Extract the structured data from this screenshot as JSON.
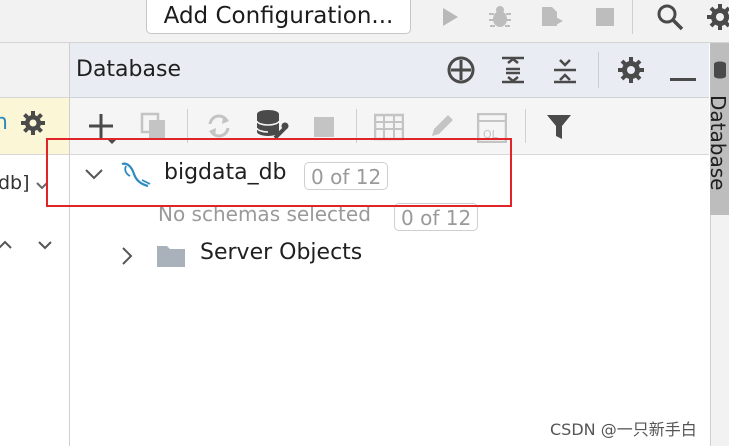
{
  "toolbar": {
    "add_configuration_label": "Add Configuration...",
    "icons": [
      "run-icon",
      "debug-icon",
      "coverage-icon",
      "stop-icon",
      "search-icon",
      "settings-icon"
    ]
  },
  "left_panel": {
    "db_label": "db]"
  },
  "database_panel": {
    "title": "Database",
    "header_icons": [
      "crosshair-icon",
      "expand-all-icon",
      "collapse-all-icon",
      "gear-icon",
      "minimize-icon"
    ],
    "toolbar_icons": [
      "add-icon",
      "duplicate-icon",
      "refresh-icon",
      "data-source-properties-icon",
      "stop-icon",
      "table-icon",
      "edit-icon",
      "query-console-icon",
      "filter-icon"
    ]
  },
  "tree": {
    "datasource": {
      "name": "bigdata_db",
      "count": "0 of 12"
    },
    "schemas": {
      "label": "No schemas selected",
      "count": "0 of 12"
    },
    "server_objects": {
      "label": "Server Objects"
    }
  },
  "right_sidebar": {
    "tab_label": "Database"
  },
  "watermark": "CSDN @一只新手白",
  "colors": {
    "highlight": "#e0242a",
    "header_bg": "#e9ecf2",
    "mysql_icon": "#2e8bc0"
  }
}
